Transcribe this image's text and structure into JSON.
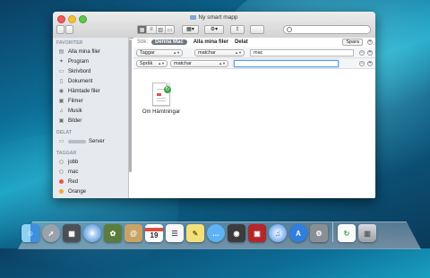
{
  "window": {
    "title": "Ny smart mapp",
    "search_placeholder": ""
  },
  "search_bar": {
    "label": "Sök:",
    "scopes": [
      "Denna Mac",
      "Alla mina filer",
      "Delat"
    ],
    "selected_scope": "Denna Mac",
    "save_label": "Spara"
  },
  "criteria": [
    {
      "attribute": "Taggar",
      "operator": "matchar",
      "value": ""
    },
    {
      "attribute": "Språk",
      "operator": "matchar",
      "value": ""
    }
  ],
  "criteria_values": {
    "row1": "mac",
    "row2": ""
  },
  "sidebar": {
    "favorites_header": "FAVORITER",
    "favorites": [
      {
        "label": "Alla mina filer",
        "icon": "all-files-icon"
      },
      {
        "label": "Program",
        "icon": "applications-icon"
      },
      {
        "label": "Skrivbord",
        "icon": "desktop-icon"
      },
      {
        "label": "Dokument",
        "icon": "documents-icon"
      },
      {
        "label": "Hämtade filer",
        "icon": "downloads-icon"
      },
      {
        "label": "Filmer",
        "icon": "movies-icon"
      },
      {
        "label": "Musik",
        "icon": "music-icon"
      },
      {
        "label": "Bilder",
        "icon": "pictures-icon"
      }
    ],
    "shared_header": "DELAT",
    "shared": [
      {
        "label": "Server",
        "icon": "server-icon"
      }
    ],
    "tags_header": "TAGGAR",
    "tags": [
      {
        "label": "jobb",
        "color": "#d9d9d9"
      },
      {
        "label": "mac",
        "color": "#d9d9d9"
      },
      {
        "label": "Red",
        "color": "#f0524c"
      },
      {
        "label": "Orange",
        "color": "#f7a531"
      }
    ]
  },
  "results": [
    {
      "name": "Om Hämtningar",
      "icon": "document-icon"
    }
  ],
  "dock": {
    "items": [
      "finder-icon",
      "launchpad-icon",
      "mission-control-icon",
      "safari-icon",
      "photos-icon",
      "contacts-icon",
      "calendar-icon",
      "reminders-icon",
      "notes-icon",
      "messages-icon",
      "facetime-icon",
      "photo-booth-icon",
      "itunes-icon",
      "app-store-icon",
      "system-preferences-icon"
    ],
    "calendar_day": "19",
    "trash_items": [
      "document-icon",
      "trash-icon"
    ]
  }
}
